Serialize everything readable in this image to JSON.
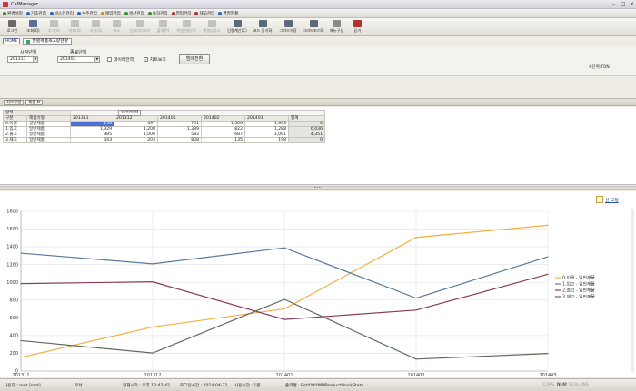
{
  "window": {
    "title": "CafManager"
  },
  "menu": [
    {
      "label": "환경설정",
      "color": "#3a8a3a"
    },
    {
      "label": "기초관리",
      "color": "#2f66b8"
    },
    {
      "label": "바스킨관리",
      "color": "#2f66b8"
    },
    {
      "label": "수주관리",
      "color": "#2f66b8"
    },
    {
      "label": "매입관리",
      "color": "#d08a20"
    },
    {
      "label": "생산관리",
      "color": "#3a8a3a"
    },
    {
      "label": "출하관리",
      "color": "#3a8a3a"
    },
    {
      "label": "영업관리",
      "color": "#b03030"
    },
    {
      "label": "재고관리",
      "color": "#b03030"
    },
    {
      "label": "경영현황",
      "color": "#2f66b8"
    }
  ],
  "toolbar": [
    {
      "label": "로그인",
      "color": "#6a6a6a",
      "disabled": false,
      "wide": false
    },
    {
      "label": "조회(Q)",
      "color": "#5a6e94",
      "disabled": false,
      "wide": false
    },
    {
      "label": "추가(A)",
      "color": "#8a8a8a",
      "disabled": true,
      "wide": false
    },
    {
      "label": "삭제(D)",
      "color": "#8a8a8a",
      "disabled": true,
      "wide": false
    },
    {
      "label": "저장(S)",
      "color": "#8a8a8a",
      "disabled": true,
      "wide": false
    },
    {
      "label": "취소",
      "color": "#8a8a8a",
      "disabled": true,
      "wide": false
    },
    {
      "label": "인쇄미리보기",
      "color": "#8a8a8a",
      "disabled": true,
      "wide": true
    },
    {
      "label": "출력(P)",
      "color": "#8a8a8a",
      "disabled": true,
      "wide": false
    },
    {
      "label": "엑셀변환(X)",
      "color": "#8a8a8a",
      "disabled": true,
      "wide": true
    },
    {
      "label": "엑셀업로드",
      "color": "#8a8a8a",
      "disabled": true,
      "wide": true
    },
    {
      "label": "단중계산(C)",
      "color": "#5a6a7a",
      "disabled": false,
      "wide": true
    },
    {
      "label": "코드 동기화",
      "color": "#5a6a7a",
      "disabled": false,
      "wide": true
    },
    {
      "label": "그리드저장",
      "color": "#5a6a7a",
      "disabled": false,
      "wide": true
    },
    {
      "label": "그리드초기화",
      "color": "#5a6a7a",
      "disabled": false,
      "wide": true
    },
    {
      "label": "메뉴구성",
      "color": "#8a8a8a",
      "disabled": false,
      "wide": false
    },
    {
      "label": "닫기",
      "color": "#b03030",
      "disabled": false,
      "wide": false
    }
  ],
  "tabs": {
    "home": "HOME",
    "active": "월별제품재고량현황"
  },
  "filter": {
    "start_label": "시작년월",
    "start_value": "201311",
    "end_label": "종료년월",
    "end_value": "201403",
    "opt_pivot": "데이터전역",
    "opt_chart": "차트보기",
    "opt_chart_checked": "✓",
    "refresh_button": "범례전환",
    "unit": "※단위:TON"
  },
  "group_bar": {
    "chip1": "자료유형",
    "chip2": "제품 N"
  },
  "grid": {
    "label_column": "항목",
    "pivot_chip": "YYYYMM",
    "headers": [
      "구분",
      "제품유형",
      "201311",
      "201312",
      "201401",
      "201402",
      "201403",
      "합계"
    ],
    "rows": [
      {
        "code": "0.이월",
        "type": "일반제품",
        "vals": [
          "154",
          "497",
          "701",
          "1,506",
          "1,643"
        ],
        "total": "0"
      },
      {
        "code": "1.입고",
        "type": "일반제품",
        "vals": [
          "1,329",
          "1,208",
          "1,389",
          "822",
          "1,288"
        ],
        "total": "6,036"
      },
      {
        "code": "2.출고",
        "type": "일반제품",
        "vals": [
          "985",
          "1,006",
          "582",
          "687",
          "1,091"
        ],
        "total": "4,351"
      },
      {
        "code": "3.재고",
        "type": "일반제품",
        "vals": [
          "343",
          "203",
          "808",
          "135",
          "198"
        ],
        "total": "0"
      }
    ]
  },
  "chart_link": "선 모형",
  "chart_data": {
    "type": "line",
    "categories": [
      "201311",
      "201312",
      "201401",
      "201402",
      "201403"
    ],
    "ylim": [
      0,
      1800
    ],
    "yticks": [
      "0",
      "200",
      "400",
      "600",
      "800",
      "1000",
      "1200",
      "1400",
      "1600",
      "1800"
    ],
    "grid": true,
    "legend_position": "right",
    "series": [
      {
        "name": "0.이월 - 일반제품",
        "color": "#f0b040",
        "values": [
          154,
          497,
          701,
          1506,
          1643
        ]
      },
      {
        "name": "1.입고 - 일반제품",
        "color": "#5a7aa0",
        "values": [
          1329,
          1208,
          1389,
          822,
          1288
        ]
      },
      {
        "name": "2.출고 - 일반제품",
        "color": "#8a3a5a",
        "values": [
          985,
          1006,
          582,
          687,
          1091
        ]
      },
      {
        "name": "3.재고 - 일반제품",
        "color": "#5e6a5e",
        "values": [
          343,
          203,
          808,
          135,
          198
        ]
      }
    ]
  },
  "status": {
    "user_label": "사용자 : root [root]",
    "dept_label": "부서 :",
    "time_label": "현재시각 : 오후 12:42:42",
    "login_label": "로그인시간 : 2014-04-22",
    "use_label": "사용시간 : 1분",
    "file_label": "출력명 : RetYYYYMMProductStockState",
    "caps": "CAPS",
    "num": "NUM",
    "scrl": "SCRL",
    "ins": "INS"
  }
}
